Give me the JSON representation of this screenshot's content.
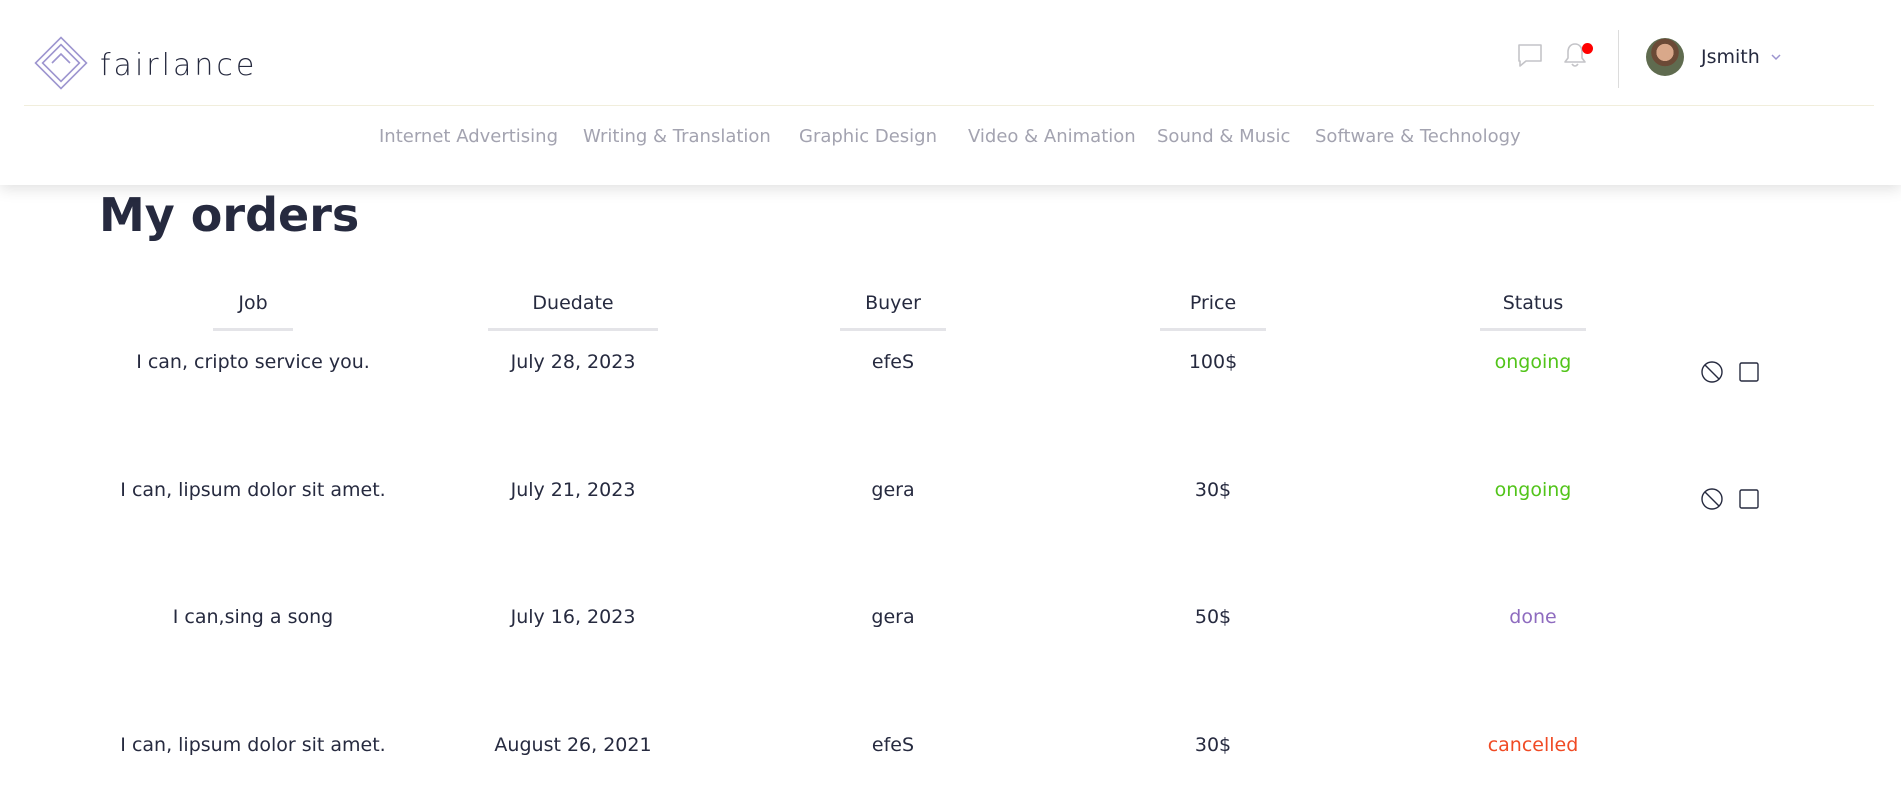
{
  "brand": {
    "name": "fairlance"
  },
  "header": {
    "username": "Jsmith",
    "icons": [
      "chat-icon",
      "bell-icon",
      "chevron-down-icon"
    ]
  },
  "nav": [
    {
      "label": "Internet Advertising"
    },
    {
      "label": "Writing & Translation"
    },
    {
      "label": "Graphic Design"
    },
    {
      "label": "Video & Animation"
    },
    {
      "label": "Sound & Music"
    },
    {
      "label": "Software & Technology"
    }
  ],
  "page": {
    "title": "My orders"
  },
  "table": {
    "columns": [
      "Job",
      "Duedate",
      "Buyer",
      "Price",
      "Status"
    ],
    "rows": [
      {
        "job": "I can, cripto service you.",
        "duedate": "July 28, 2023",
        "buyer": "efeS",
        "price": "100$",
        "status": "ongoing",
        "actions": true
      },
      {
        "job": "I can, lipsum dolor sit amet.",
        "duedate": "July 21, 2023",
        "buyer": "gera",
        "price": "30$",
        "status": "ongoing",
        "actions": true
      },
      {
        "job": "I can,sing a song",
        "duedate": "July 16, 2023",
        "buyer": "gera",
        "price": "50$",
        "status": "done",
        "actions": false
      },
      {
        "job": "I can, lipsum dolor sit amet.",
        "duedate": "August 26, 2021",
        "buyer": "efeS",
        "price": "30$",
        "status": "cancelled",
        "actions": false
      }
    ]
  },
  "colors": {
    "ongoing": "#52c41a",
    "done": "#8e6bbf",
    "cancelled": "#f04a24",
    "notification": "#ff0000",
    "brand_outline": "#9c94cf"
  }
}
